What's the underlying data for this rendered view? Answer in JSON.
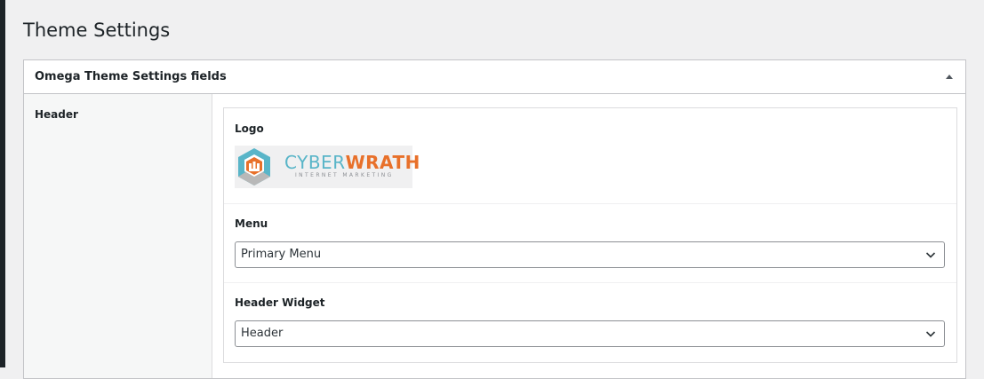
{
  "page": {
    "title": "Theme Settings"
  },
  "metabox": {
    "title": "Omega Theme Settings fields",
    "toggle_icon": "triangle-up-icon"
  },
  "tabs": [
    {
      "label": "Header"
    }
  ],
  "fields": {
    "logo": {
      "label": "Logo",
      "logo_text_part1": "CYBER",
      "logo_text_part2": "WRATH",
      "logo_tagline": "INTERNET MARKETING",
      "colors": {
        "teal": "#59b5c8",
        "orange": "#e8702a",
        "gray": "#b8b8b8"
      }
    },
    "menu": {
      "label": "Menu",
      "value": "Primary Menu",
      "icon": "chevron-down-icon"
    },
    "header_widget": {
      "label": "Header Widget",
      "value": "Header",
      "icon": "chevron-down-icon"
    }
  }
}
